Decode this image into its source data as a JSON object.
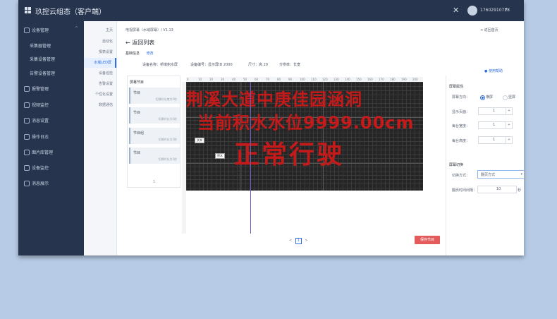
{
  "app": {
    "title": "玖控云组态（客户端）",
    "user_name": "17602910728",
    "close_glyph": "✕",
    "caret_glyph": "▾"
  },
  "sidebar": {
    "items": [
      {
        "label": "设备管理",
        "expanded": true
      },
      {
        "label": "采集器管理",
        "sub": true
      },
      {
        "label": "采集设备管理",
        "sub": true
      },
      {
        "label": "告警设备管理",
        "sub": true
      },
      {
        "label": "报警管理"
      },
      {
        "label": "视频监控"
      },
      {
        "label": "消息设置"
      },
      {
        "label": "操作日志"
      },
      {
        "label": "图片库管理"
      },
      {
        "label": "设备监控"
      },
      {
        "label": "消息展示"
      }
    ]
  },
  "subnav": {
    "items": [
      "主页",
      "自动化",
      "报表设置",
      "水域LED屏",
      "设备巡检",
      "告警设置",
      "个性化设置",
      "数据通信"
    ],
    "active_index": 3
  },
  "main": {
    "breadcrumb": "电视屏幕（水域屏幕）/ V1.13",
    "back_link": "< 返回首页",
    "title": "← 返回列表",
    "section": "基础信息",
    "section_link": "修改",
    "info": [
      "设备名称：桥墩积水屏",
      "设备编号：显示屏ID 2000",
      "尺寸：高 20",
      "分辨率：长宽"
    ],
    "help_link": "使用帮助"
  },
  "program_panel": {
    "title": "屏幕节目",
    "items": [
      {
        "name": "节目",
        "meta": "切换时长度为5秒"
      },
      {
        "name": "节目",
        "meta": "切换时长为5秒"
      },
      {
        "name": "节目组",
        "meta": "切换时长为5秒"
      },
      {
        "name": "节目",
        "meta": "切换时长为5秒"
      }
    ],
    "page": "1"
  },
  "led": {
    "line1": "荆溪大道中庚佳园涵洞",
    "line2": "当前积水水位9999.00cm",
    "line3": "正常行驶",
    "tag1": "文本",
    "tag2": "积水",
    "ruler_ticks": [
      "0",
      "10",
      "20",
      "30",
      "40",
      "50",
      "60",
      "70",
      "80",
      "90",
      "100",
      "110",
      "120",
      "130",
      "140",
      "150",
      "160",
      "170",
      "180",
      "190",
      "200"
    ]
  },
  "canvas": {
    "page_prev": "<",
    "page_num": "1",
    "page_next": ">",
    "save_label": "保存节目"
  },
  "props": {
    "screen_title": "屏幕属性",
    "direction_label": "屏幕方向：",
    "direction_options": [
      "横屏",
      "竖屏"
    ],
    "fields": [
      {
        "label": "显示页面：",
        "value": "1"
      },
      {
        "label": "每台宽度：",
        "value": "1"
      },
      {
        "label": "每台高度：",
        "value": "1"
      }
    ],
    "switch_title": "屏幕切换",
    "switch_mode_label": "切换方式：",
    "switch_mode_value": "翻页方式",
    "switch_time_label": "翻页时间间隔：",
    "switch_time_value": "10",
    "switch_time_unit": "秒"
  }
}
